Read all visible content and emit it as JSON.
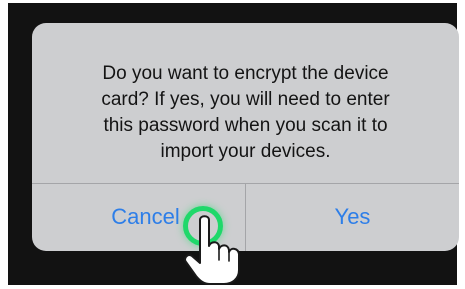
{
  "dialog": {
    "message_lines": [
      "Do you want to encrypt the device",
      "card? If yes, you will need to enter",
      "this password when you scan it to",
      "import your devices."
    ],
    "cancel_label": "Cancel",
    "yes_label": "Yes"
  },
  "colors": {
    "dialog_background": "#cdced0",
    "button_text": "#2d7ee8",
    "tap_indicator": "#1fd86a",
    "screen_background": "#121212"
  },
  "overlays": {
    "tap_indicator_icon": "tap-ring-icon",
    "pointer_icon": "hand-pointer-icon"
  }
}
